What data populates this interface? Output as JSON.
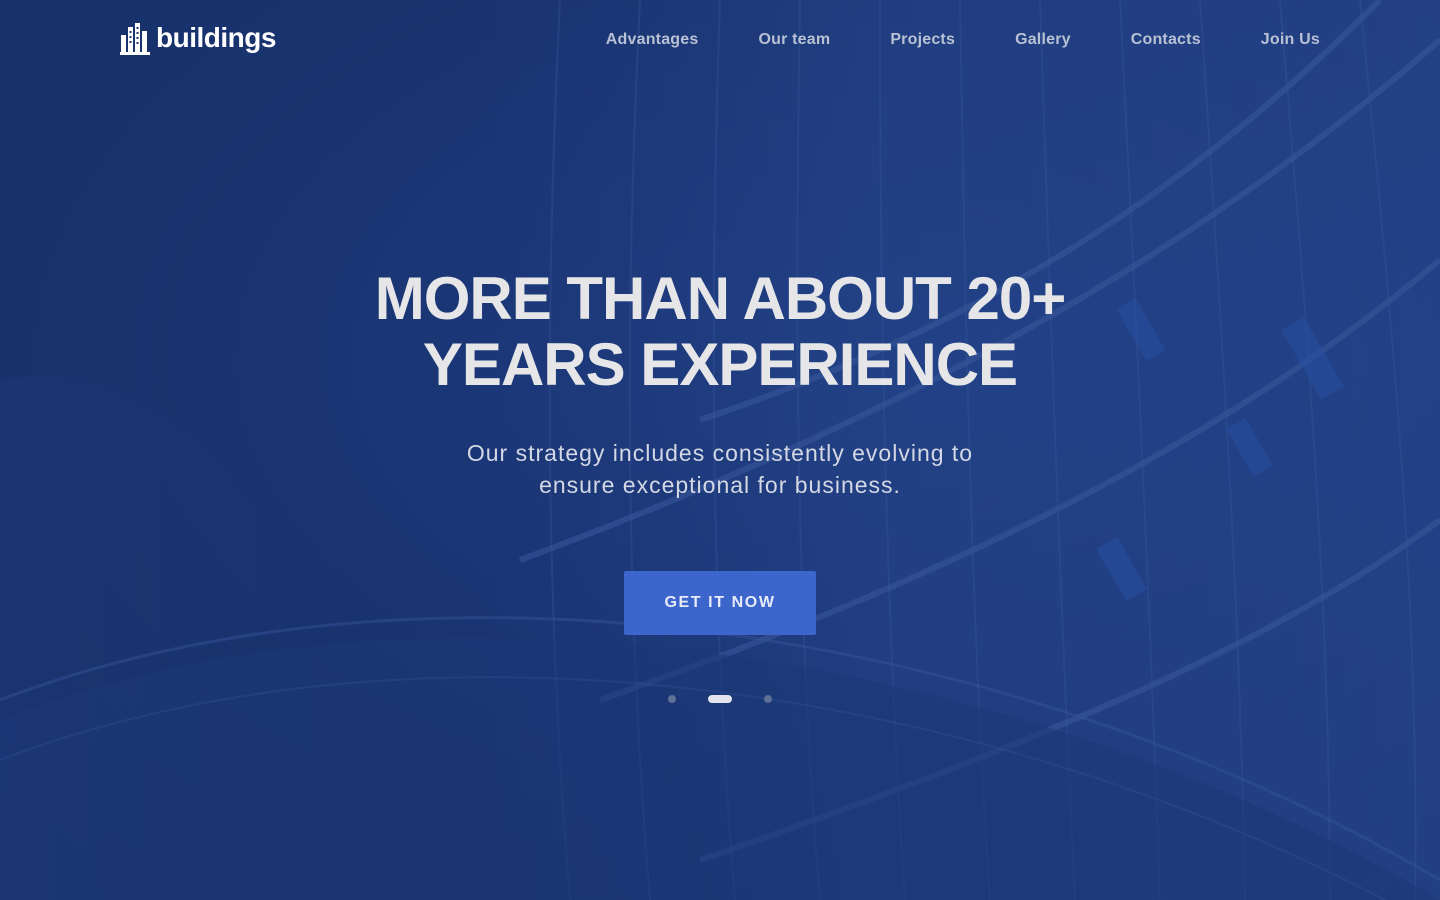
{
  "brand": {
    "name": "buildings",
    "icon": "buildings-icon"
  },
  "nav": {
    "items": [
      {
        "label": "Advantages"
      },
      {
        "label": "Our team"
      },
      {
        "label": "Projects"
      },
      {
        "label": "Gallery"
      },
      {
        "label": "Contacts"
      },
      {
        "label": "Join Us"
      }
    ]
  },
  "hero": {
    "headline_line1": "MORE THAN ABOUT 20+",
    "headline_line2": "YEARS EXPERIENCE",
    "subtitle_line1": "Our strategy includes consistently evolving to",
    "subtitle_line2": "ensure exceptional for business.",
    "cta_label": "GET IT NOW",
    "slides_total": 3,
    "active_slide": 2
  },
  "colors": {
    "background": "#1b3470",
    "accent": "#3d66cc",
    "nav_text": "#b9c1d4",
    "headline_text": "#e6e6e8"
  }
}
